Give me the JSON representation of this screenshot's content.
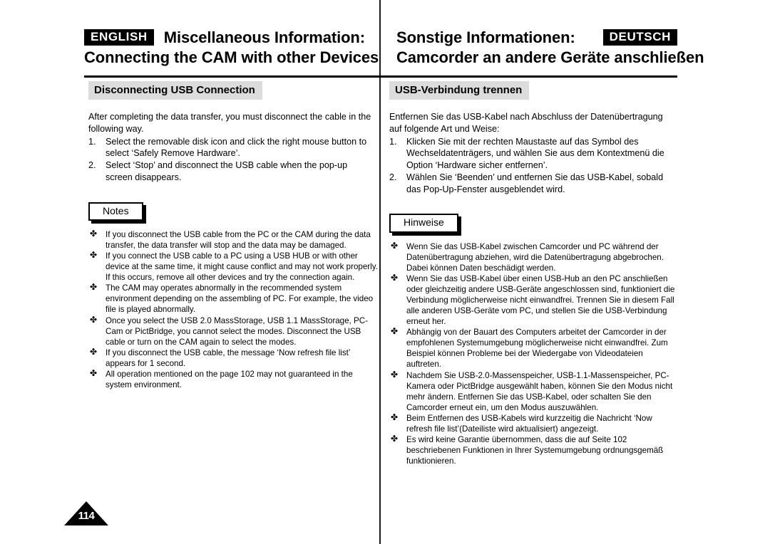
{
  "page": {
    "number": "114",
    "divider_color": "#1a1a1a",
    "heading_bg": "#dcdcdc"
  },
  "header": {
    "left": {
      "badge": "ENGLISH",
      "title_line1": "Miscellaneous Information:",
      "title_line2": "Connecting the CAM with other Devices"
    },
    "right": {
      "badge": "DEUTSCH",
      "title_line1": "Sonstige Informationen:",
      "title_line2": "Camcorder an andere Geräte anschließen"
    }
  },
  "left_column": {
    "section_heading": "Disconnecting USB Connection",
    "intro": "After completing the data transfer, you must disconnect the cable in the following way.",
    "steps": [
      {
        "num": "1.",
        "text": "Select the removable disk icon and click the right mouse button to select ‘Safely Remove Hardware’."
      },
      {
        "num": "2.",
        "text": "Select ‘Stop’ and disconnect the USB cable when the pop-up screen disappears."
      }
    ],
    "notes_label": "Notes",
    "notes": [
      "If you disconnect the USB cable from the PC or the CAM during the data transfer, the data transfer will stop and the data may be damaged.",
      "If you connect the USB cable to a PC using a USB HUB or with other device at the same time, it might cause conflict and may not work properly. If this occurs, remove all other devices and try the connection again.",
      "The CAM may operates abnormally in the recommended system environment depending on the assembling of PC. For example, the video file is played abnormally.",
      "Once you select the USB 2.0 MassStorage, USB 1.1 MassStorage, PC-Cam or PictBridge, you cannot select the modes. Disconnect the USB cable or turn on the CAM again to select the modes.",
      "If you disconnect the USB cable, the message ‘Now refresh file list’ appears for 1 second.",
      "All operation mentioned on the page 102 may not guaranteed in the system environment."
    ]
  },
  "right_column": {
    "section_heading": "USB-Verbindung trennen",
    "intro": "Entfernen Sie das USB-Kabel nach Abschluss der Datenübertragung auf folgende Art und Weise:",
    "steps": [
      {
        "num": "1.",
        "text": "Klicken Sie mit der rechten Maustaste auf das Symbol des Wechseldatenträgers, und wählen Sie aus dem Kontextmenü die Option ‘Hardware sicher entfernen’."
      },
      {
        "num": "2.",
        "text": "Wählen Sie ‘Beenden’ und entfernen Sie das USB-Kabel, sobald das Pop-Up-Fenster ausgeblendet wird."
      }
    ],
    "notes_label": "Hinweise",
    "notes": [
      "Wenn Sie das USB-Kabel zwischen Camcorder und PC während der Datenübertragung abziehen, wird die Datenübertragung abgebrochen. Dabei können Daten beschädigt werden.",
      "Wenn Sie das USB-Kabel über einen USB-Hub an den PC anschließen oder gleichzeitig andere USB-Geräte angeschlossen sind, funktioniert die Verbindung möglicherweise nicht einwandfrei. Trennen Sie in diesem Fall alle anderen USB-Geräte vom PC, und stellen Sie die USB-Verbindung erneut her.",
      "Abhängig von der Bauart des Computers arbeitet der Camcorder in der empfohlenen Systemumgebung möglicherweise nicht einwandfrei. Zum Beispiel können Probleme bei der Wiedergabe von Videodateien auftreten.",
      "Nachdem Sie USB-2.0-Massenspeicher, USB-1.1-Massenspeicher, PC-Kamera oder PictBridge ausgewählt haben, können Sie den Modus nicht mehr ändern. Entfernen Sie das USB-Kabel, oder schalten Sie den Camcorder erneut ein, um den Modus auszuwählen.",
      "Beim Entfernen des USB-Kabels wird kurzzeitig die Nachricht ‘Now refresh file list’(Dateiliste wird aktualisiert) angezeigt.",
      "Es wird keine Garantie übernommen, dass die auf Seite 102 beschriebenen Funktionen in Ihrer Systemumgebung ordnungsgemäß funktionieren."
    ]
  },
  "icons": {
    "note_bullet": "✤"
  }
}
